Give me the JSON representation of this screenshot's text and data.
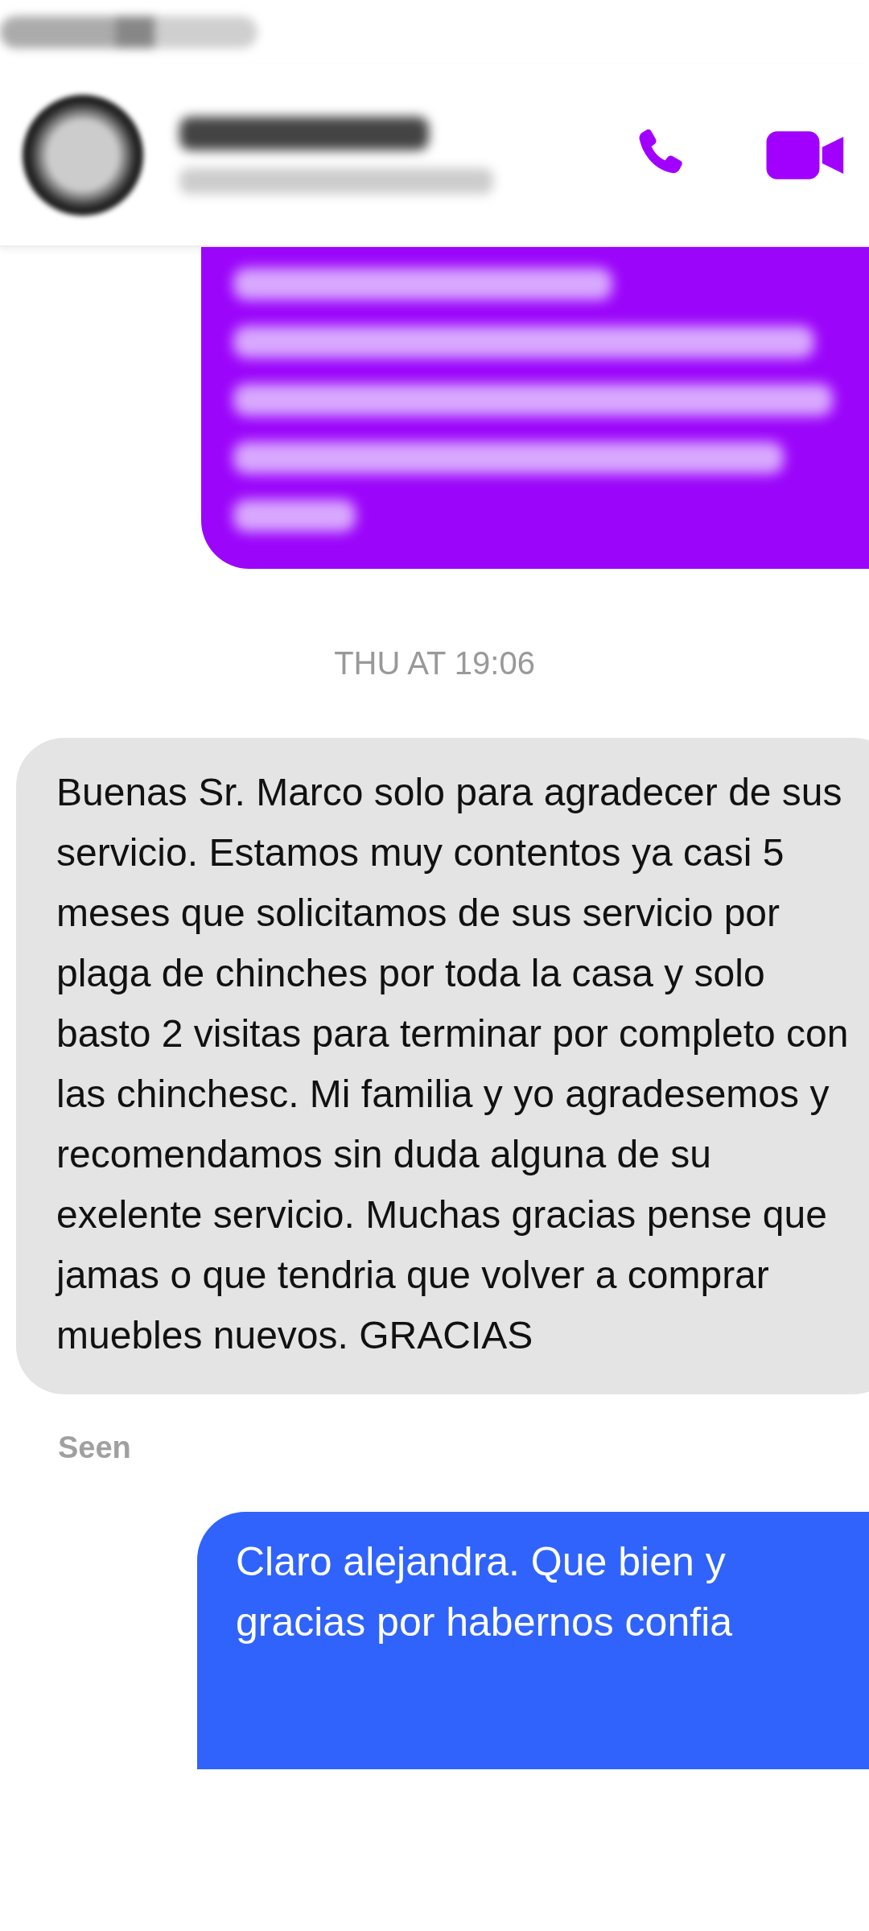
{
  "messages": [
    {
      "kind": "outgoing_blurred",
      "color": "#9b06fa"
    },
    {
      "kind": "timestamp",
      "text": "THU AT 19:06"
    },
    {
      "kind": "incoming",
      "text": "Buenas Sr. Marco solo para agradecer de sus servicio. Estamos muy contentos ya casi 5 meses que solicitamos de sus servicio por plaga de chinches por toda la casa y solo basto 2 visitas para terminar por completo con las chinchesc. Mi familia y yo agradesemos y recomendamos sin duda alguna de su exelente servicio. Muchas gracias pense que jamas o que tendria que volver a comprar muebles nuevos. GRACIAS"
    },
    {
      "kind": "seen",
      "text": "Seen"
    },
    {
      "kind": "outgoing",
      "color": "#2f63fb",
      "lines": [
        "Claro alejandra. Que bien y",
        "gracias por habernos confia"
      ]
    }
  ]
}
